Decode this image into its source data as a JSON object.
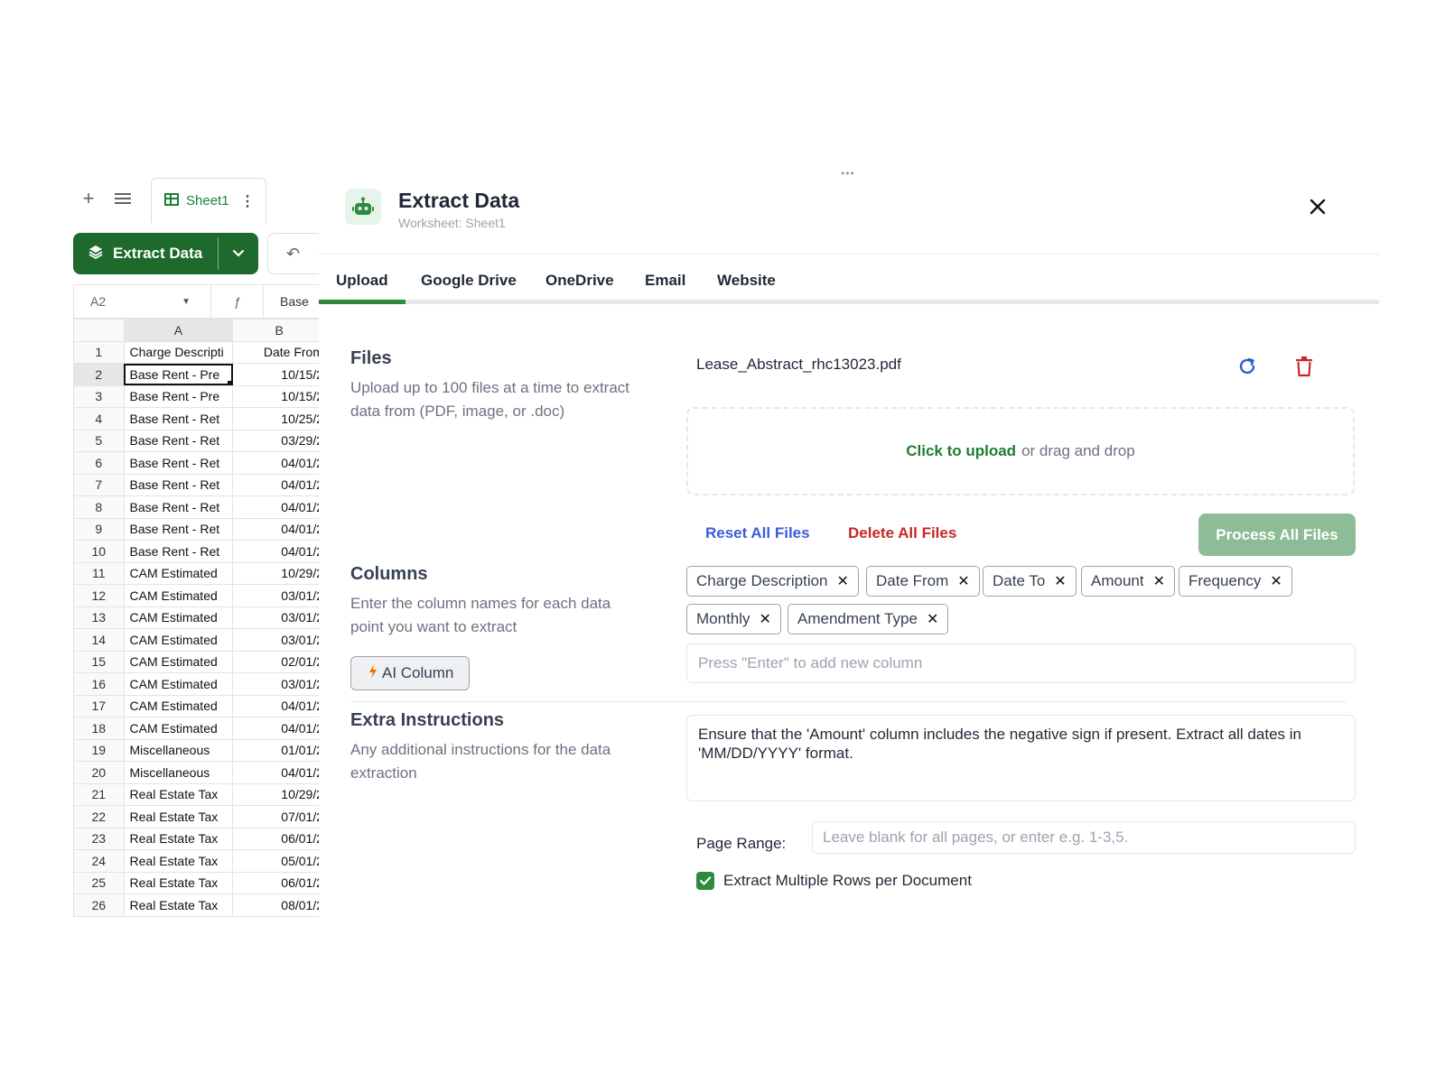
{
  "sheet": {
    "tab_name": "Sheet1",
    "extract_button_label": "Extract Data",
    "name_box": "A2",
    "formula_value": "Base",
    "col_headers": [
      "A",
      "B"
    ],
    "rows": [
      {
        "n": "1",
        "a": "Charge Descripti",
        "b": "Date From"
      },
      {
        "n": "2",
        "a": "Base Rent - Pre",
        "b": "10/15/2"
      },
      {
        "n": "3",
        "a": "Base Rent - Pre",
        "b": "10/15/2"
      },
      {
        "n": "4",
        "a": "Base Rent - Ret",
        "b": "10/25/2"
      },
      {
        "n": "5",
        "a": "Base Rent - Ret",
        "b": "03/29/2"
      },
      {
        "n": "6",
        "a": "Base Rent - Ret",
        "b": "04/01/2"
      },
      {
        "n": "7",
        "a": "Base Rent - Ret",
        "b": "04/01/2"
      },
      {
        "n": "8",
        "a": "Base Rent - Ret",
        "b": "04/01/2"
      },
      {
        "n": "9",
        "a": "Base Rent - Ret",
        "b": "04/01/2"
      },
      {
        "n": "10",
        "a": "Base Rent - Ret",
        "b": "04/01/2"
      },
      {
        "n": "11",
        "a": "CAM Estimated",
        "b": "10/29/2"
      },
      {
        "n": "12",
        "a": "CAM Estimated",
        "b": "03/01/2"
      },
      {
        "n": "13",
        "a": "CAM Estimated",
        "b": "03/01/2"
      },
      {
        "n": "14",
        "a": "CAM Estimated",
        "b": "03/01/2"
      },
      {
        "n": "15",
        "a": "CAM Estimated",
        "b": "02/01/2"
      },
      {
        "n": "16",
        "a": "CAM Estimated",
        "b": "03/01/2"
      },
      {
        "n": "17",
        "a": "CAM Estimated",
        "b": "04/01/2"
      },
      {
        "n": "18",
        "a": "CAM Estimated",
        "b": "04/01/2"
      },
      {
        "n": "19",
        "a": "Miscellaneous",
        "b": "01/01/2"
      },
      {
        "n": "20",
        "a": "Miscellaneous",
        "b": "04/01/2"
      },
      {
        "n": "21",
        "a": "Real Estate Tax",
        "b": "10/29/2"
      },
      {
        "n": "22",
        "a": "Real Estate Tax",
        "b": "07/01/2"
      },
      {
        "n": "23",
        "a": "Real Estate Tax",
        "b": "06/01/2"
      },
      {
        "n": "24",
        "a": "Real Estate Tax",
        "b": "05/01/2"
      },
      {
        "n": "25",
        "a": "Real Estate Tax",
        "b": "06/01/2"
      },
      {
        "n": "26",
        "a": "Real Estate Tax",
        "b": "08/01/2"
      }
    ]
  },
  "panel": {
    "title": "Extract Data",
    "subtitle": "Worksheet: Sheet1",
    "tabs": [
      {
        "label": "Upload",
        "active": true
      },
      {
        "label": "Google Drive",
        "active": false
      },
      {
        "label": "OneDrive",
        "active": false
      },
      {
        "label": "Email",
        "active": false
      },
      {
        "label": "Website",
        "active": false
      }
    ],
    "files": {
      "title": "Files",
      "description": "Upload up to 100 files at a time to extract data from (PDF, image, or .doc)",
      "file_name": "Lease_Abstract_rhc13023.pdf",
      "dropzone_link": "Click to upload",
      "dropzone_text": "or drag and drop",
      "reset_label": "Reset All Files",
      "delete_label": "Delete All Files",
      "process_label": "Process All Files"
    },
    "columns": {
      "title": "Columns",
      "description": "Enter the column names for each data point you want to extract",
      "ai_button_label": "AI Column",
      "chips": [
        "Charge Description",
        "Date From",
        "Date To",
        "Amount",
        "Frequency",
        "Monthly",
        "Amendment Type"
      ],
      "input_placeholder": "Press \"Enter\" to add new column"
    },
    "instructions": {
      "title": "Extra Instructions",
      "description": "Any additional instructions for the data extraction",
      "value": "Ensure that the 'Amount' column includes the negative sign if present. Extract all dates in 'MM/DD/YYYY' format.",
      "page_range_label": "Page Range:",
      "page_range_placeholder": "Leave blank for all pages, or enter e.g. 1-3,5.",
      "checkbox_label": "Extract Multiple Rows per Document",
      "checkbox_checked": true
    }
  },
  "colors": {
    "brand_green": "#1e6a2c",
    "accent_green": "#2e8b3e",
    "reset_blue": "#3b5bdb",
    "delete_red": "#c62828",
    "process_disabled": "#8ebc96"
  },
  "icons": {
    "add_sheet": "plus-icon",
    "all_sheets": "menu-icon",
    "sheet_grid": "grid-icon",
    "robot": "robot-icon",
    "close": "close-icon",
    "refresh": "refresh-icon",
    "trash": "trash-icon",
    "bolt": "bolt-icon",
    "check": "check-icon"
  }
}
